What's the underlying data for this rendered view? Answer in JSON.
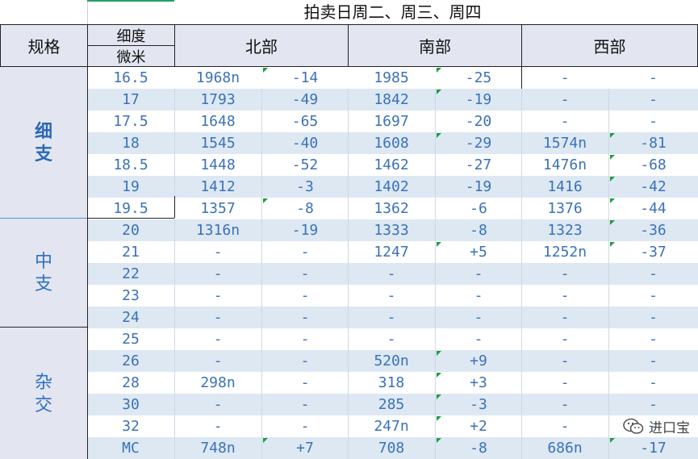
{
  "title": "拍卖日周二、周三、周四",
  "header": {
    "spec": "规格",
    "fineness_line1": "细度",
    "fineness_line2": "微米",
    "north": "北部",
    "south": "南部",
    "west": "西部"
  },
  "groups": [
    {
      "line1": "细",
      "line2": "支"
    },
    {
      "line1": "中",
      "line2": "支"
    },
    {
      "line1": "杂",
      "line2": "交"
    }
  ],
  "rows": [
    [
      "16.5",
      "1968n",
      "-14",
      "1985",
      "-25",
      "-",
      "-"
    ],
    [
      "17",
      "1793",
      "-49",
      "1842",
      "-19",
      "-",
      "-"
    ],
    [
      "17.5",
      "1648",
      "-65",
      "1697",
      "-20",
      "-",
      "-"
    ],
    [
      "18",
      "1545",
      "-40",
      "1608",
      "-29",
      "1574n",
      "-81"
    ],
    [
      "18.5",
      "1448",
      "-52",
      "1462",
      "-27",
      "1476n",
      "-68"
    ],
    [
      "19",
      "1412",
      "-3",
      "1402",
      "-19",
      "1416",
      "-42"
    ],
    [
      "19.5",
      "1357",
      "-8",
      "1362",
      "-6",
      "1376",
      "-44"
    ],
    [
      "20",
      "1316n",
      "-19",
      "1333",
      "-8",
      "1323",
      "-36"
    ],
    [
      "21",
      "-",
      "-",
      "1247",
      "+5",
      "1252n",
      "-37"
    ],
    [
      "22",
      "-",
      "-",
      "-",
      "-",
      "-",
      "-"
    ],
    [
      "23",
      "-",
      "-",
      "-",
      "-",
      "-",
      "-"
    ],
    [
      "24",
      "-",
      "-",
      "-",
      "-",
      "-",
      "-"
    ],
    [
      "25",
      "-",
      "-",
      "-",
      "-",
      "-",
      "-"
    ],
    [
      "26",
      "-",
      "-",
      "520n",
      "+9",
      "-",
      "-"
    ],
    [
      "28",
      "298n",
      "-",
      "318",
      "+3",
      "-",
      "-"
    ],
    [
      "30",
      "-",
      "-",
      "285",
      "-3",
      "-",
      "-"
    ],
    [
      "32",
      "-",
      "-",
      "247n",
      "+2",
      "-",
      "-"
    ],
    [
      "MC",
      "748n",
      "+7",
      "708",
      "-8",
      "686n",
      "-17"
    ]
  ],
  "watermark": {
    "text": "进口宝",
    "icon": "wechat-icon"
  },
  "colors": {
    "header_bg": "#e3e6f0",
    "stripe": "#dde8f3",
    "text": "#3b72b6",
    "marker": "#1b9e3e"
  }
}
